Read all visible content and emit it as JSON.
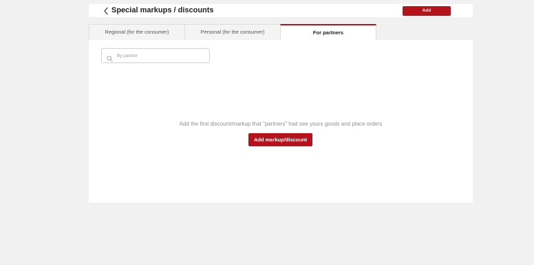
{
  "header": {
    "back_icon": "chevron-left-icon",
    "title": "Special markups / discounts",
    "add_label": "Add"
  },
  "tabs": [
    {
      "label": "Regional (for the consumer)",
      "active": false
    },
    {
      "label": "Personal (for the consumer)",
      "active": false
    },
    {
      "label": "For partners",
      "active": true
    }
  ],
  "search": {
    "icon": "search-icon",
    "placeholder": "By partner",
    "value": ""
  },
  "empty_state": {
    "message": "Add the first discount/markup that \"partners\" had see yours goods and place orders",
    "button_label": "Add markup/discount"
  },
  "colors": {
    "accent": "#b5121b",
    "background": "#f1f1f1",
    "panel": "#ffffff"
  }
}
